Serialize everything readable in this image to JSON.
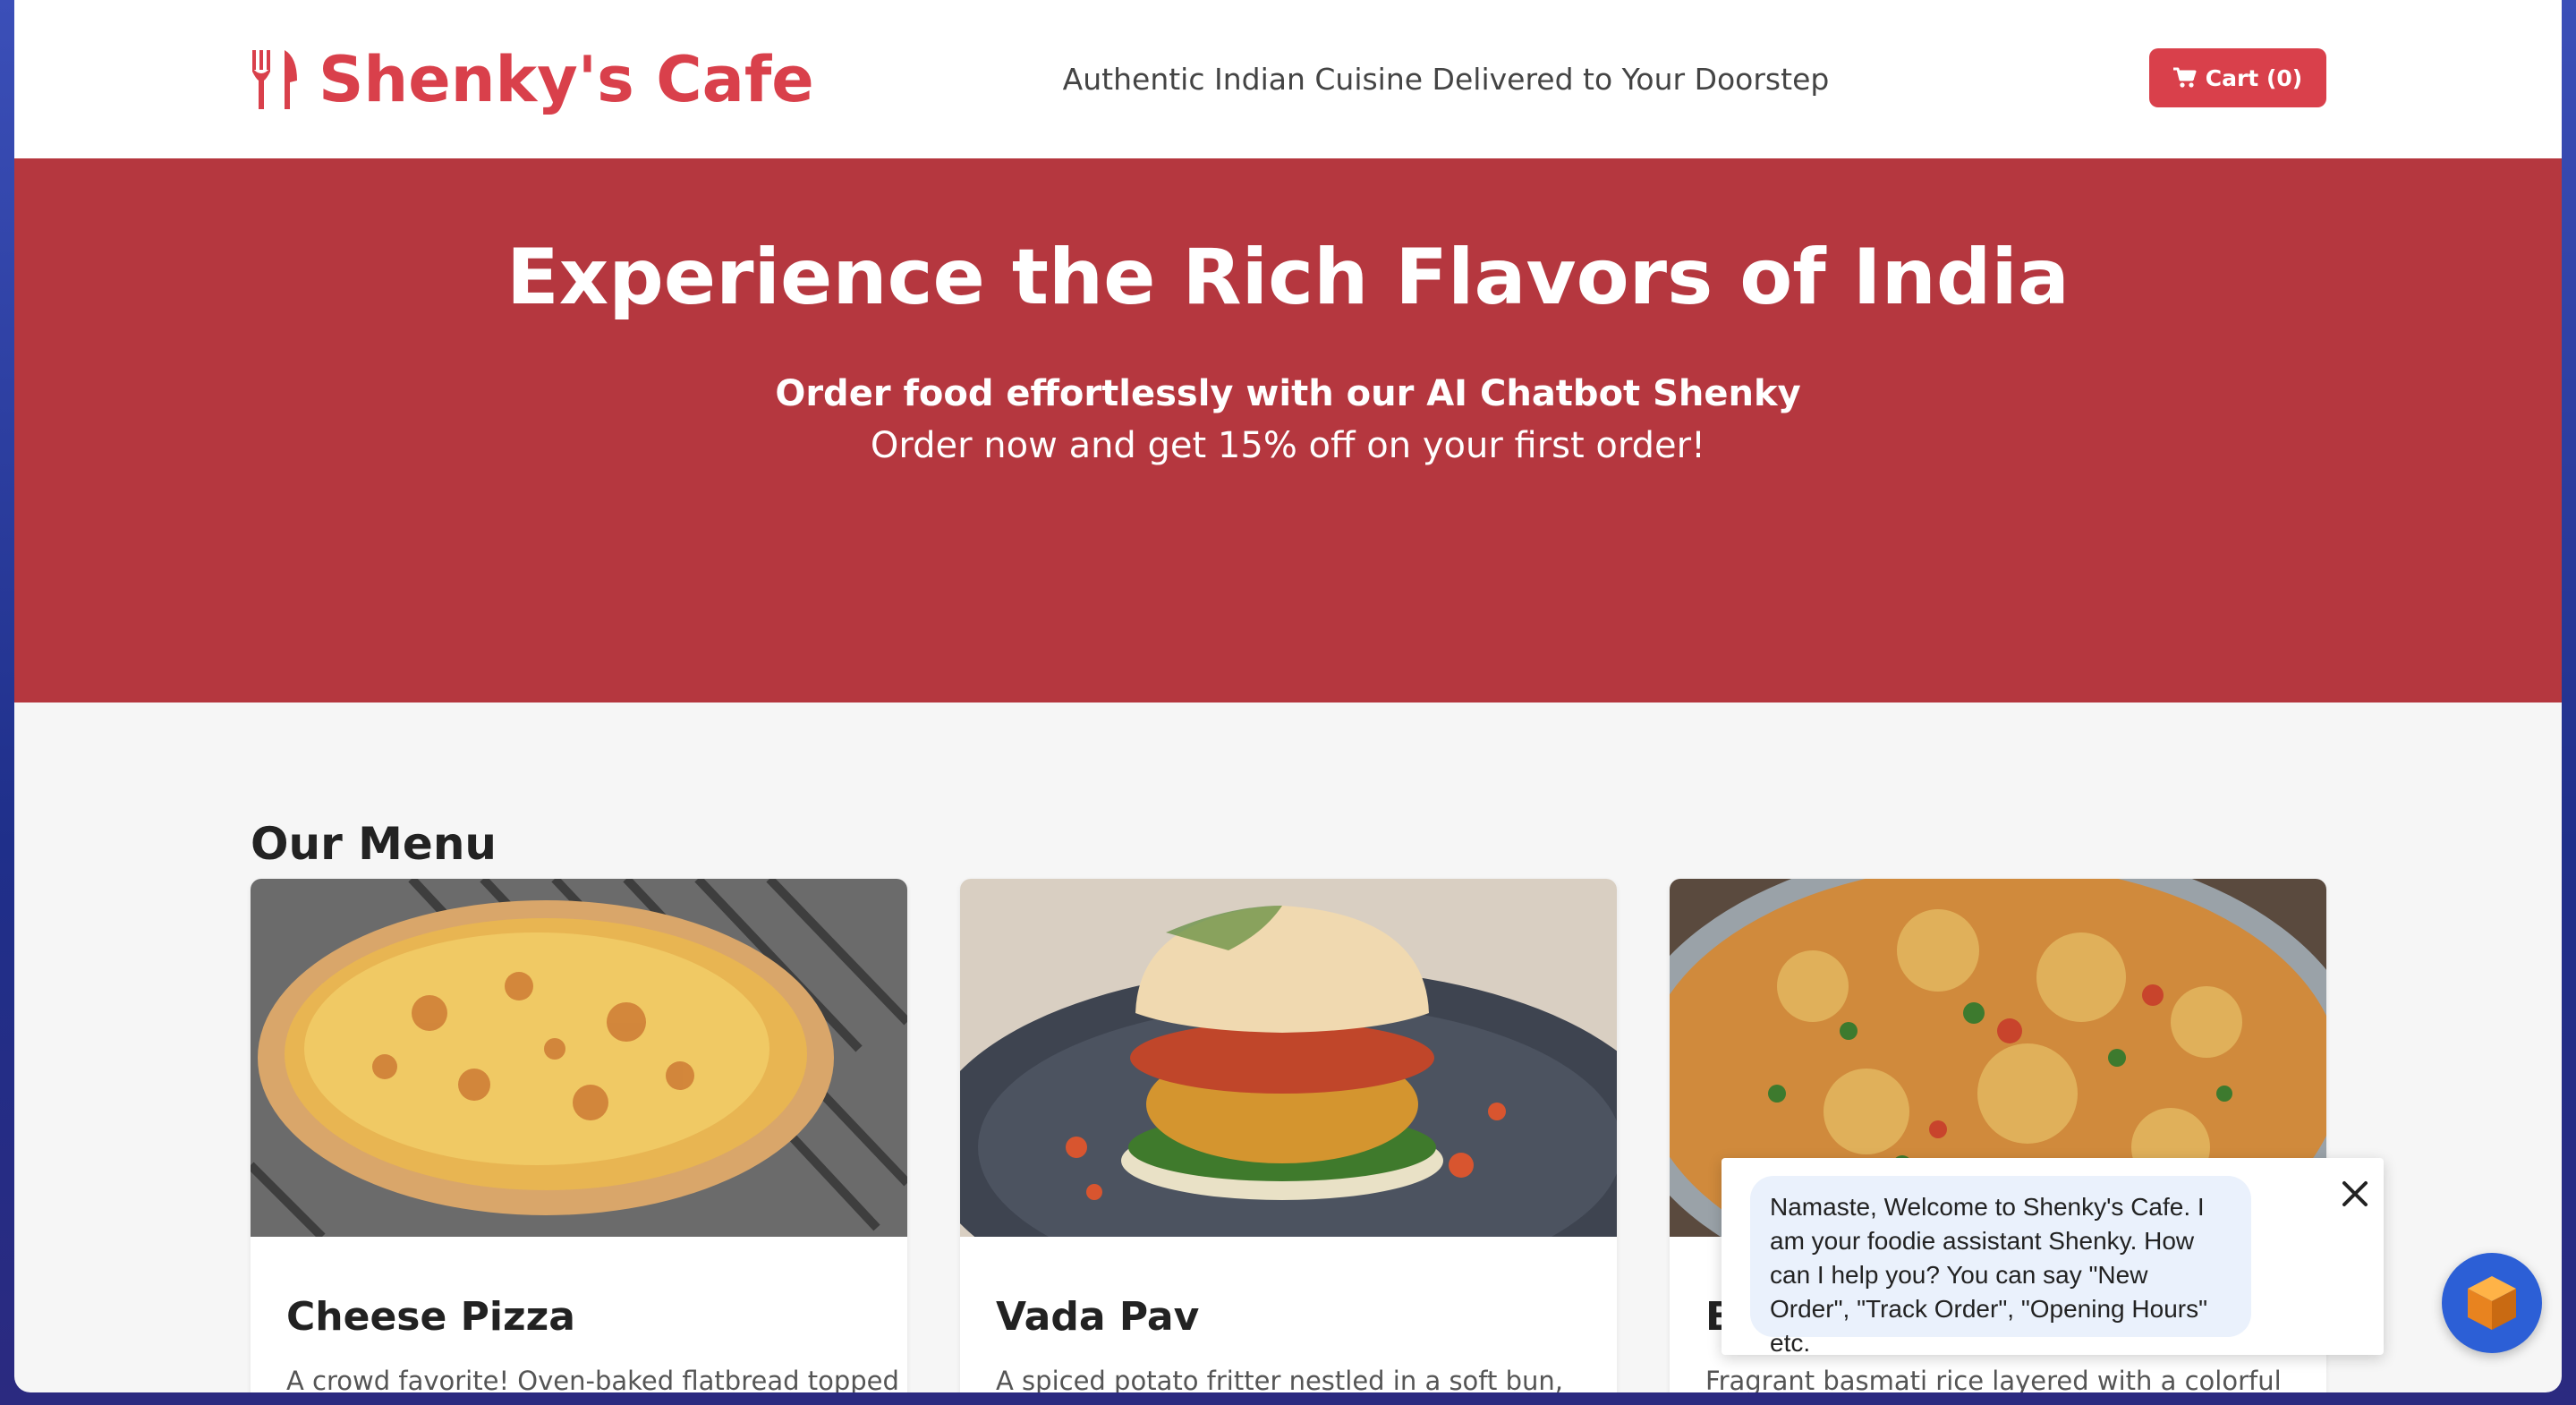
{
  "header": {
    "brand": "Shenky's Cafe",
    "brand_icon": "fork-knife-icon",
    "tagline": "Authentic Indian Cuisine Delivered to Your Doorstep",
    "cart_label": "Cart (0)",
    "cart_icon": "shopping-cart-icon"
  },
  "hero": {
    "title": "Experience the Rich Flavors of India",
    "subtitle": "Order food effortlessly with our AI Chatbot Shenky",
    "offer": "Order now and get 15% off on your first order!"
  },
  "menu": {
    "title": "Our Menu",
    "items": [
      {
        "name": "Cheese Pizza",
        "description": "A crowd favorite! Oven-baked flatbread topped"
      },
      {
        "name": "Vada Pav",
        "description": "A spiced potato fritter nestled in a soft bun,"
      },
      {
        "name": "B",
        "description": "Fragrant basmati rice layered with a colorful"
      }
    ]
  },
  "chat": {
    "message": "Namaste, Welcome to Shenky's Cafe. I am your foodie assistant Shenky. How can I help you? You can say \"New Order\", \"Track Order\", \"Opening Hours\" etc.",
    "close_icon": "close-icon",
    "launcher_icon": "cube-icon"
  },
  "colors": {
    "brand": "#d9404b",
    "hero_bg": "#b5373f",
    "page_bg": "#f6f6f6",
    "chat_bubble": "#eaf1fc",
    "launcher": "#2c5fd6"
  }
}
